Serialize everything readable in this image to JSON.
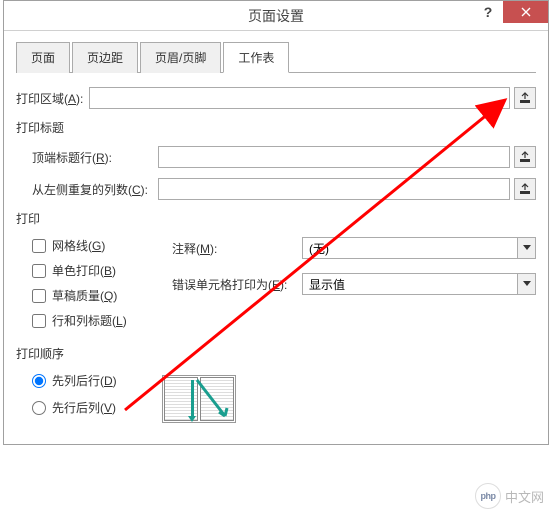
{
  "title": "页面设置",
  "tabs": [
    "页面",
    "页边距",
    "页眉/页脚",
    "工作表"
  ],
  "activeTab": 3,
  "printArea": {
    "label_pre": "打印区域(",
    "label_u": "A",
    "label_post": "):",
    "value": ""
  },
  "printTitles": {
    "heading": "打印标题",
    "topRow": {
      "label_pre": "顶端标题行(",
      "label_u": "R",
      "label_post": "):",
      "value": ""
    },
    "leftCol": {
      "label_pre": "从左侧重复的列数(",
      "label_u": "C",
      "label_post": "):",
      "value": ""
    }
  },
  "print": {
    "heading": "打印",
    "checks": {
      "grid": {
        "pre": "网格线(",
        "u": "G",
        "post": ")",
        "checked": false
      },
      "mono": {
        "pre": "单色打印(",
        "u": "B",
        "post": ")",
        "checked": false
      },
      "draft": {
        "pre": "草稿质量(",
        "u": "Q",
        "post": ")",
        "checked": false
      },
      "rowcol": {
        "pre": "行和列标题(",
        "u": "L",
        "post": ")",
        "checked": false
      }
    },
    "comment": {
      "label_pre": "注释(",
      "label_u": "M",
      "label_post": "):",
      "value": "(无)"
    },
    "errors": {
      "label_pre": "错误单元格打印为(",
      "label_u": "E",
      "label_post": "):",
      "value": "显示值"
    }
  },
  "order": {
    "heading": "打印顺序",
    "downOver": {
      "pre": "先列后行(",
      "u": "D",
      "post": ")",
      "selected": true
    },
    "overDown": {
      "pre": "先行后列(",
      "u": "V",
      "post": ")",
      "selected": false
    }
  },
  "watermark": {
    "logo": "php",
    "text": "中文网"
  }
}
